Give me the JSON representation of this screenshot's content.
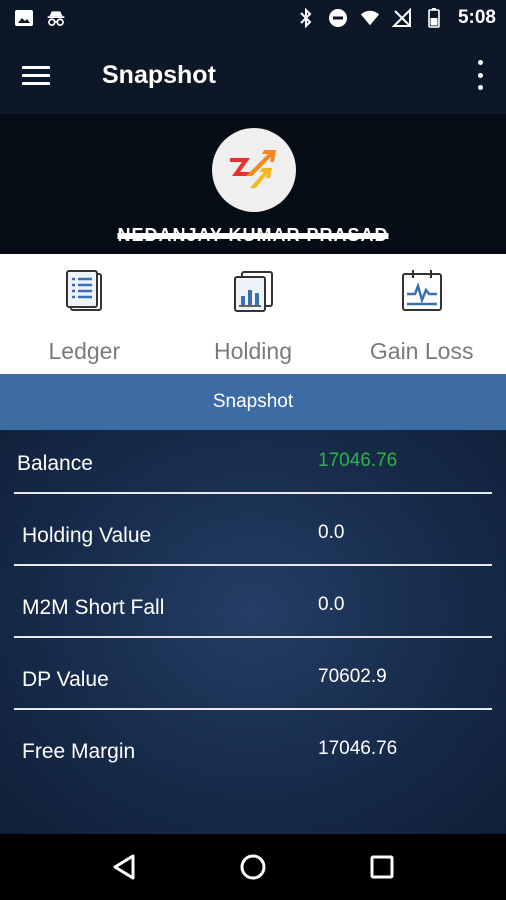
{
  "status_bar": {
    "time": "5:08",
    "icons_left": [
      "image-icon",
      "incognito-icon"
    ],
    "icons_right": [
      "bluetooth-icon",
      "do-not-disturb-icon",
      "wifi-icon",
      "no-signal-icon",
      "battery-icon"
    ]
  },
  "app_bar": {
    "title": "Snapshot",
    "menu_icon": "hamburger-menu-icon",
    "overflow_icon": "more-vert-icon"
  },
  "profile": {
    "name": "NEDANJAY KUMAR PRASAD"
  },
  "quick_nav": [
    {
      "label": "Ledger",
      "icon": "ledger-icon"
    },
    {
      "label": "Holding",
      "icon": "holding-icon"
    },
    {
      "label": "Gain Loss",
      "icon": "gain-loss-icon"
    }
  ],
  "snapshot": {
    "header": "Snapshot",
    "rows": [
      {
        "label": "Balance",
        "value": "17046.76"
      },
      {
        "label": "Holding Value",
        "value": "0.0"
      },
      {
        "label": "M2M Short Fall",
        "value": "0.0"
      },
      {
        "label": "DP Value",
        "value": "70602.9"
      },
      {
        "label": "Free Margin",
        "value": "17046.76"
      }
    ]
  },
  "colors": {
    "app_bar": "#0c1727",
    "snapshot_header": "#3d6ca4",
    "positive_value": "#2fb14a",
    "icon_blue": "#3a6fb0"
  }
}
